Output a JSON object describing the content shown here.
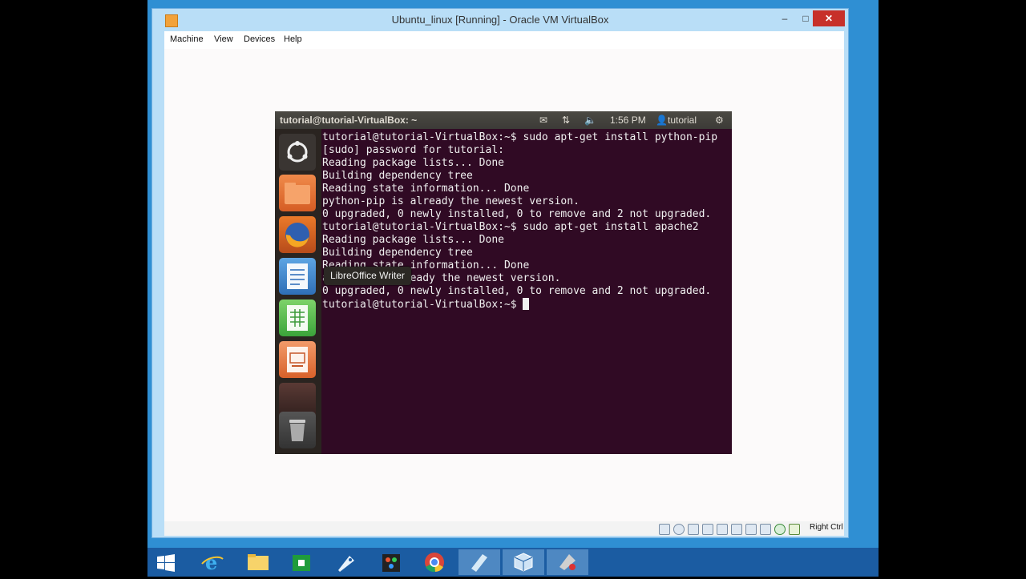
{
  "window": {
    "title": "Ubuntu_linux [Running] - Oracle VM VirtualBox",
    "minimize_glyph": "–",
    "maximize_glyph": "□",
    "close_glyph": "✕"
  },
  "menubar": {
    "items": [
      "Machine",
      "View",
      "Devices",
      "Help"
    ]
  },
  "ubuntu": {
    "panel_title": "tutorial@tutorial-VirtualBox: ~",
    "clock": "1:56 PM",
    "user": "tutorial",
    "icons": [
      "mail-icon",
      "network-icon",
      "volume-icon",
      "user-icon",
      "gear-icon"
    ]
  },
  "terminal": {
    "lines": [
      "tutorial@tutorial-VirtualBox:~$ sudo apt-get install python-pip",
      "[sudo] password for tutorial:",
      "Reading package lists... Done",
      "Building dependency tree",
      "Reading state information... Done",
      "python-pip is already the newest version.",
      "0 upgraded, 0 newly installed, 0 to remove and 2 not upgraded.",
      "tutorial@tutorial-VirtualBox:~$ sudo apt-get install apache2",
      "Reading package lists... Done",
      "Building dependency tree",
      "Reading state information... Done",
      "apache2 is already the newest version.",
      "0 upgraded, 0 newly installed, 0 to remove and 2 not upgraded.",
      "tutorial@tutorial-VirtualBox:~$ "
    ]
  },
  "tooltip": {
    "text": "LibreOffice Writer"
  },
  "statusbar": {
    "host_key": "Right Ctrl"
  },
  "taskbar": {
    "items": [
      "start-button",
      "internet-explorer-icon",
      "file-explorer-icon",
      "store-icon",
      "rocket-app-icon",
      "paint-app-icon",
      "chrome-icon",
      "notepad-icon",
      "virtualbox-icon",
      "tool-app-icon"
    ],
    "active": [
      "virtualbox-icon"
    ]
  },
  "colors": {
    "terminal_bg": "#300a24",
    "taskbar": "#1b5ca2",
    "desktop": "#2f8fd3"
  }
}
